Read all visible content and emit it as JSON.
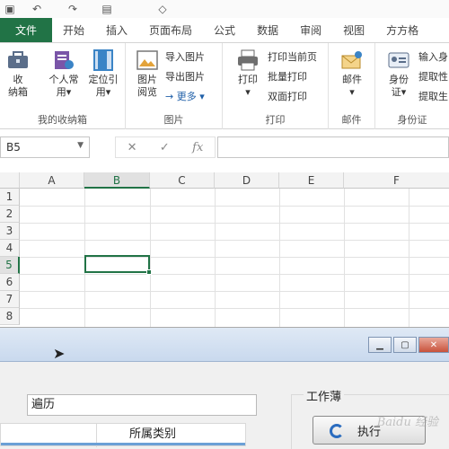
{
  "ribbon_tabs": [
    "文件",
    "开始",
    "插入",
    "页面布局",
    "公式",
    "数据",
    "审阅",
    "视图",
    "方方格"
  ],
  "groups": {
    "collection": {
      "label": "我的收纳箱",
      "buttons": [
        "收\n纳箱",
        "个人常\n用▾",
        "定位引\n用▾"
      ]
    },
    "image": {
      "label": "图片",
      "big": "图片\n阅览",
      "small": [
        "导入图片",
        "导出图片",
        "→ 更多 ▾"
      ]
    },
    "print": {
      "label": "打印",
      "big": "打印\n▾",
      "small": [
        "打印当前页",
        "批量打印",
        "双面打印"
      ]
    },
    "mail": {
      "label": "邮件",
      "big": "邮件\n▾"
    },
    "idcard": {
      "label": "身份证",
      "big": "身份\n证▾",
      "small": [
        "输入身",
        "提取性",
        "提取生"
      ]
    }
  },
  "formula_bar": {
    "name_box": "B5",
    "cancel": "✕",
    "enter": "✓",
    "fx": "fx"
  },
  "grid": {
    "columns": [
      "A",
      "B",
      "C",
      "D",
      "E",
      "F"
    ],
    "rows": [
      "1",
      "2",
      "3",
      "4",
      "5",
      "6",
      "7",
      "8"
    ],
    "selected_column": "B",
    "selected_row": "5"
  },
  "dialog": {
    "search_value": "遍历",
    "column_header": "所属类别",
    "workbook_group": "工作薄",
    "run_button": "执行",
    "watermark": "Baidu 经验",
    "window_buttons": [
      "▁",
      "▢",
      "✕"
    ]
  }
}
